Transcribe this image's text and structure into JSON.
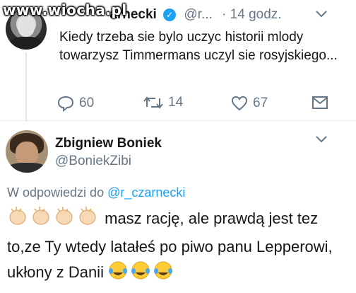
{
  "watermark": {
    "text": "www.wiocha.pl"
  },
  "tweet1": {
    "name": "r_czarnecki",
    "name_visible": "arnecki",
    "handle": "@r...",
    "time": "· 14 godz.",
    "text": "Kiedy trzeba sie bylo uczyc historii mlody towarzysz Timmermans uczyl sie rosyjskiego...",
    "replies": "60",
    "retweets": "14",
    "likes": "67"
  },
  "tweet2": {
    "name": "Zbigniew Boniek",
    "handle": "@BoniekZibi",
    "reply_prefix": "W odpowiedzi do",
    "reply_mention": "@r_czarnecki",
    "text_part1": "masz rację, ale prawdą jest tez to,ze Ty wtedy latałeś po piwo panu Lepperowi, ukłony z Danii"
  },
  "colors": {
    "accent": "#1da1f2",
    "muted": "#657786",
    "text": "#14171a"
  },
  "icons": {
    "reply": "reply-icon",
    "retweet": "retweet-icon",
    "like": "heart-icon",
    "dm": "envelope-icon",
    "verified": "verified-badge-icon",
    "chevron": "chevron-down-icon",
    "clap": "clapping-hands-emoji",
    "laugh": "tears-of-joy-emoji"
  }
}
